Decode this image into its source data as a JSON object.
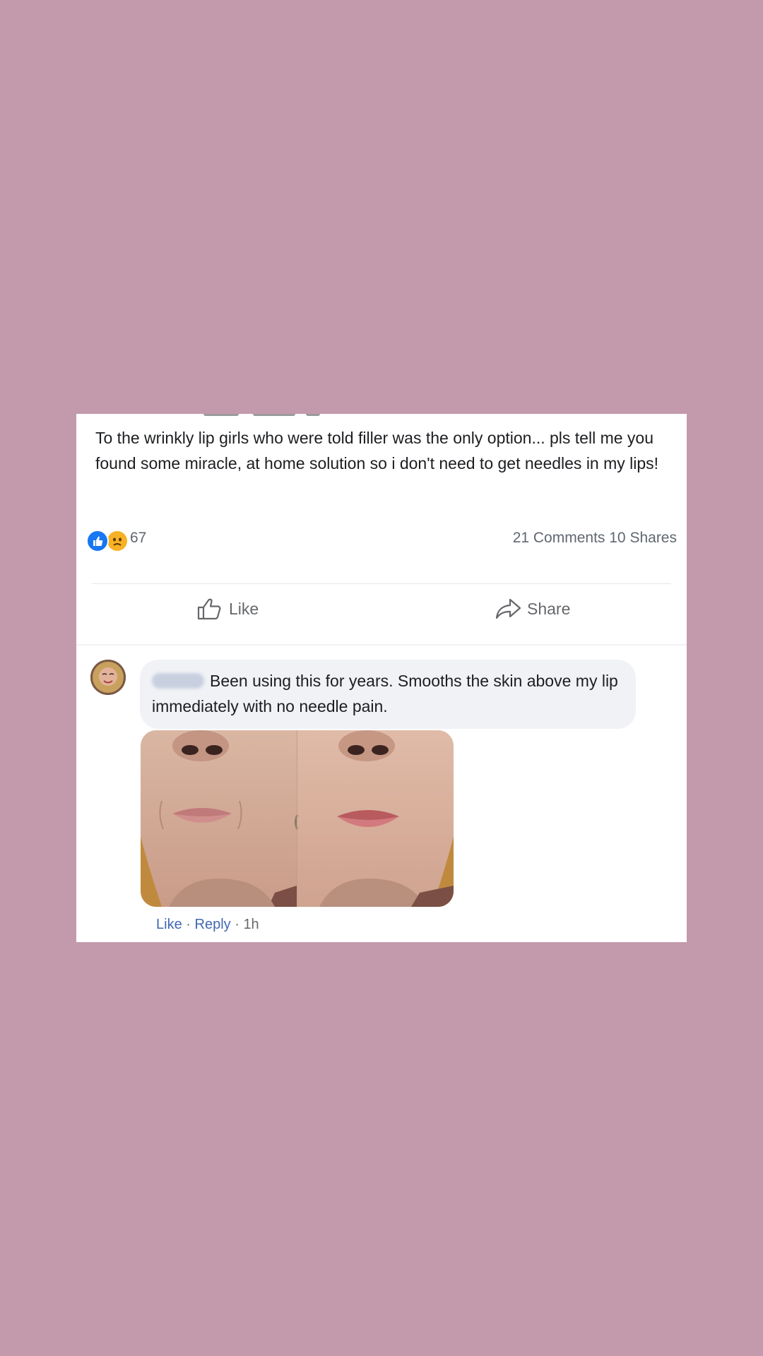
{
  "post": {
    "text": "To the wrinkly lip girls who were told filler was the only option... pls tell me you found some miracle, at home solution so i don't need to get needles in my lips!",
    "reactions": {
      "icons": [
        "like-reaction-icon",
        "sad-reaction-icon"
      ],
      "count": "67"
    },
    "stats": "21 Comments 10 Shares",
    "actions": {
      "like_label": "Like",
      "share_label": "Share"
    }
  },
  "comment": {
    "text": "Been using this for years. Smooths the skin above my lip immediately with no needle pain.",
    "footer": {
      "like": "Like",
      "reply": "Reply",
      "separator": "·",
      "time": "1h"
    }
  },
  "colors": {
    "background": "#c39aab",
    "card": "#ffffff",
    "like_blue": "#1877f2",
    "sad_yellow": "#f7b125",
    "link": "#4267b2",
    "muted": "#606770"
  }
}
